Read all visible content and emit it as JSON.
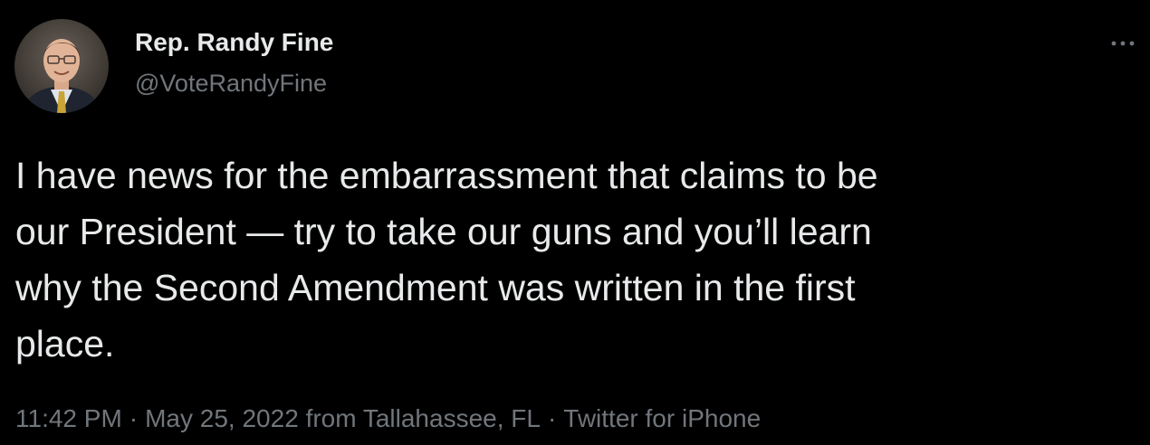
{
  "author": {
    "name": "Rep. Randy Fine",
    "handle": "@VoteRandyFine"
  },
  "tweet": {
    "text": "I have news for the embarrassment that claims to be\nour President — try to take our guns and you’ll learn\nwhy the Second Amendment was written in the first\nplace."
  },
  "meta": {
    "time": "11:42 PM",
    "separator": "·",
    "date": "May 25, 2022",
    "location": "from Tallahassee, FL",
    "source": "Twitter for iPhone"
  },
  "icons": {
    "more": "more-horizontal-icon"
  },
  "colors": {
    "background": "#000000",
    "primary_text": "#e7e9ea",
    "secondary_text": "#71767b"
  }
}
